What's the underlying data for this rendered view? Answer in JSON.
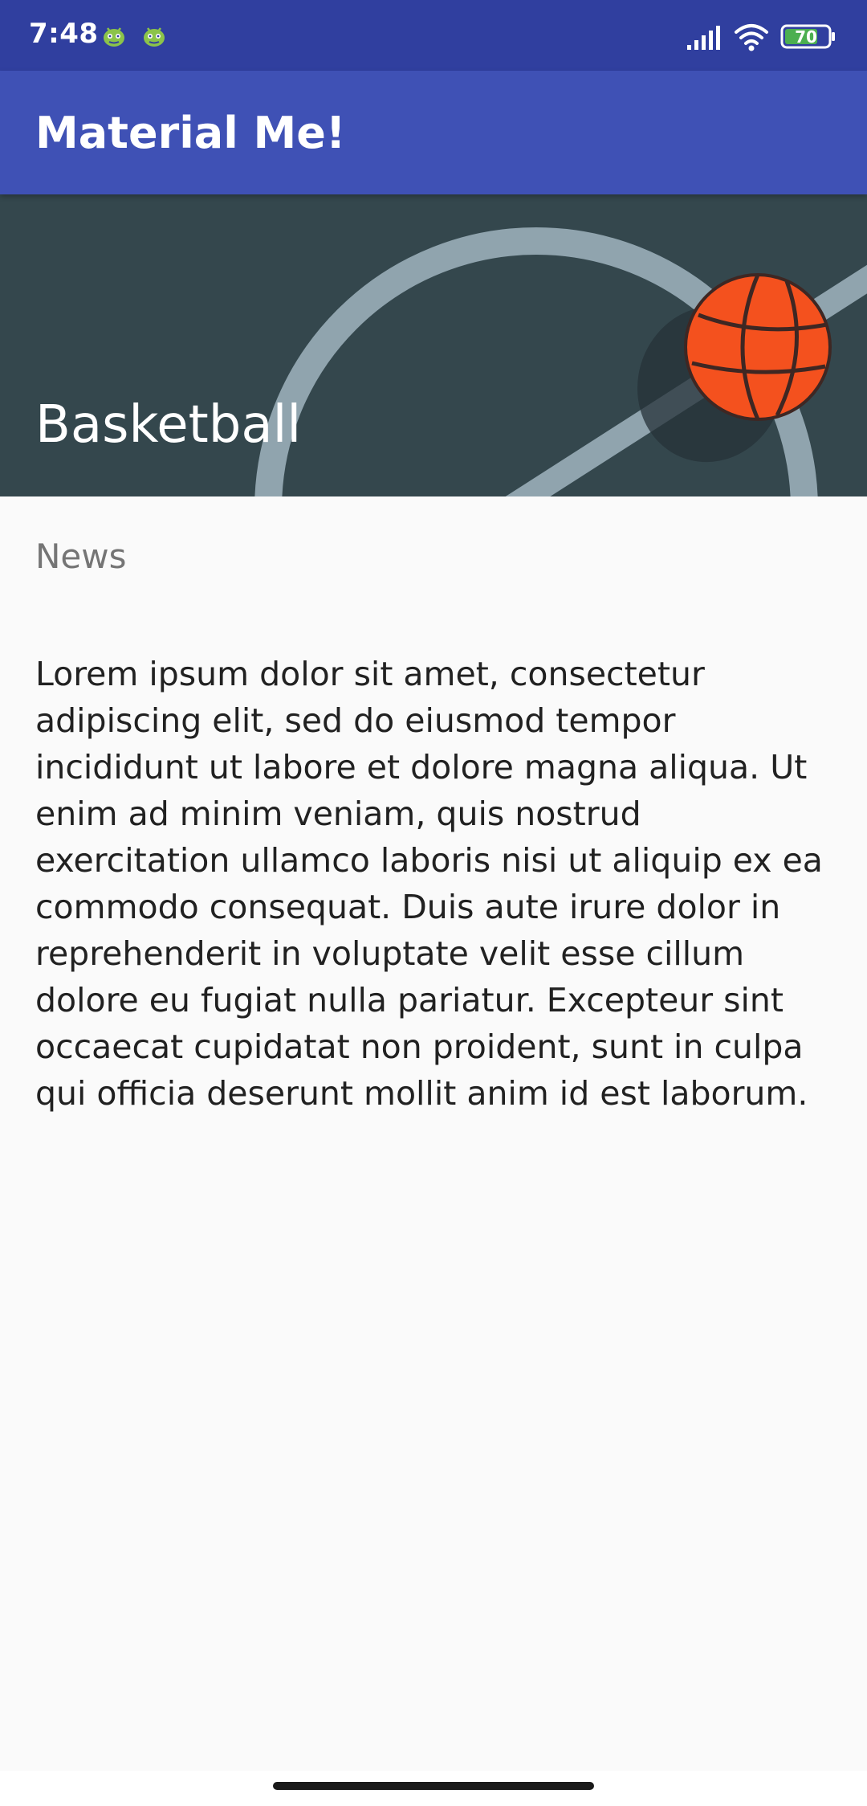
{
  "status_bar": {
    "time": "7:48",
    "notification_icons": [
      "android-debug-icon",
      "android-debug-icon"
    ],
    "signal_icon": "signal-icon",
    "wifi_icon": "wifi-icon",
    "battery_level": "70",
    "battery_color": "#4caf50"
  },
  "app_bar": {
    "title": "Material Me!",
    "color": "#3f51b5"
  },
  "header": {
    "title": "Basketball",
    "image_icon": "basketball-court-image"
  },
  "content": {
    "subtitle": "News",
    "body": "Lorem ipsum dolor sit amet, consectetur adipiscing elit, sed do eiusmod tempor incididunt ut labore et dolore magna aliqua. Ut enim ad minim veniam, quis nostrud exercitation ullamco laboris nisi ut aliquip ex ea commodo consequat. Duis aute irure dolor in reprehenderit in voluptate velit esse cillum dolore eu fugiat nulla pariatur. Excepteur sint occaecat cupidatat non proident, sunt in culpa qui officia deserunt mollit anim id est laborum."
  },
  "colors": {
    "status_bar": "#303f9f",
    "primary": "#3f51b5",
    "header_bg": "#34474d",
    "ball": "#f4511e"
  }
}
